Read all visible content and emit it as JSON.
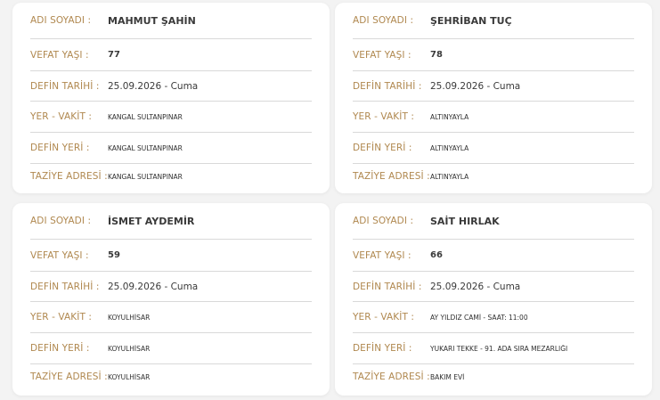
{
  "labels": {
    "name": "ADI SOYADI :",
    "age": "VEFAT YAŞI :",
    "date": "DEFİN TARİHİ :",
    "time": "YER - VAKİT :",
    "place": "DEFİN YERİ :",
    "address": "TAZİYE ADRESİ :"
  },
  "cards": [
    {
      "name": "MAHMUT ŞAHİN",
      "age": "77",
      "date": "25.09.2026 - Cuma",
      "time": "KANGAL SULTANPINAR",
      "place": "KANGAL SULTANPINAR",
      "address": "KANGAL SULTANPINAR"
    },
    {
      "name": "ŞEHRİBAN TUÇ",
      "age": "78",
      "date": "25.09.2026 - Cuma",
      "time": "ALTINYAYLA",
      "place": "ALTINYAYLA",
      "address": "ALTINYAYLA"
    },
    {
      "name": "İSMET AYDEMİR",
      "age": "59",
      "date": "25.09.2026 - Cuma",
      "time": "KOYULHİSAR",
      "place": "KOYULHİSAR",
      "address": "KOYULHİSAR"
    },
    {
      "name": "SAİT HIRLAK",
      "age": "66",
      "date": "25.09.2026 - Cuma",
      "time": "AY YILDIZ CAMİ - SAAT: 11:00",
      "place": "YUKARI TEKKE - 91. ADA SIRA MEZARLIĞI",
      "address": "BAKIM EVİ"
    }
  ]
}
